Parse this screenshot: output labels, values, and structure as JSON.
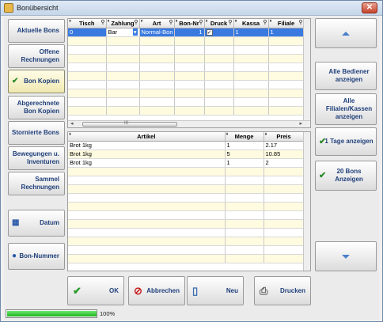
{
  "window": {
    "title": "Bonübersicht",
    "close_symbol": "✕"
  },
  "left_menu": [
    {
      "label": "Aktuelle Bons",
      "icon": ""
    },
    {
      "label": "Offene Rechnungen",
      "icon": ""
    },
    {
      "label": "Bon Kopien",
      "icon": "check-icon"
    },
    {
      "label": "Abgerechnete Bon Kopien",
      "icon": ""
    },
    {
      "label": "Stornierte Bons",
      "icon": ""
    },
    {
      "label": "Bewegungen u. Inventuren",
      "icon": ""
    },
    {
      "label": "Sammel Rechnungen",
      "icon": ""
    },
    {
      "label": "Datum",
      "icon": "calendar-icon"
    },
    {
      "label": "Bon-Nummer",
      "icon": "globe-icon"
    }
  ],
  "right_menu": {
    "all_waiters": "Alle Bediener anzeigen",
    "all_branches": "Alle Filialen/Kassen anzeigen",
    "days": "1 Tage anzeigen",
    "bons": "20 Bons Anzeigen"
  },
  "bon_grid": {
    "columns": [
      "Tisch",
      "Zahlung",
      "Art",
      "Bon-Nr",
      "Druck",
      "Kassa",
      "Filiale"
    ],
    "rows": [
      {
        "tisch": "0",
        "zahlung": "Bar",
        "art": "Normal-Bon",
        "bon_nr": "1",
        "druck": "✓",
        "kassa": "1",
        "filiale": "1"
      }
    ],
    "scroll_marker": "III"
  },
  "article_grid": {
    "columns": [
      "Artikel",
      "Menge",
      "Preis"
    ],
    "rows": [
      {
        "artikel": "Brot 1kg",
        "menge": "1",
        "preis": "2.17"
      },
      {
        "artikel": "Brot 1kg",
        "menge": "5",
        "preis": "10.85"
      },
      {
        "artikel": "Brot 1kg",
        "menge": "1",
        "preis": "2"
      }
    ]
  },
  "actions": {
    "ok": "OK",
    "cancel": "Abbrechen",
    "new": "Neu",
    "print": "Drucken"
  },
  "progress": {
    "value": 1.0,
    "label": "100%"
  },
  "colors": {
    "accent": "#3a7ae0",
    "button_text": "#1f3f7a",
    "row_alt": "#fffbe0",
    "progress": "#1fb21f"
  }
}
